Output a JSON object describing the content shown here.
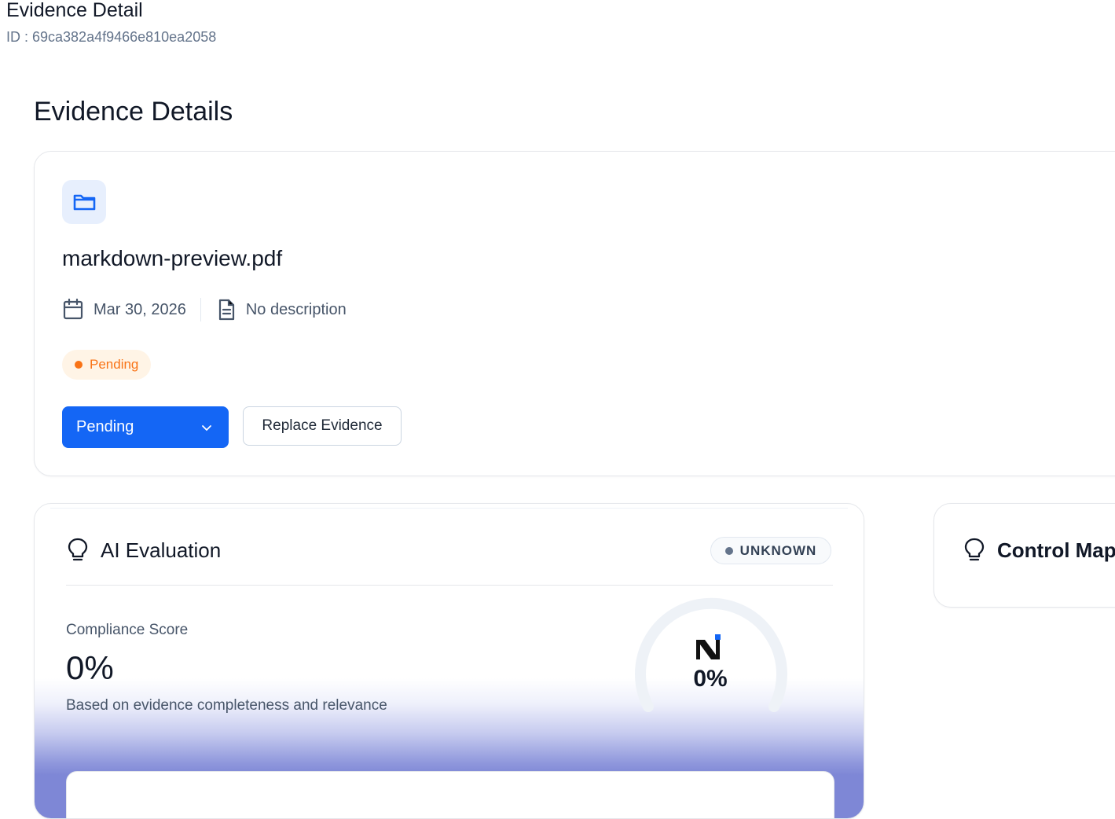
{
  "header": {
    "title": "Evidence Detail",
    "id_label": "ID : 69ca382a4f9466e810ea2058"
  },
  "section": {
    "title": "Evidence Details"
  },
  "evidence": {
    "icon": "folder-icon",
    "file_name": "markdown-preview.pdf",
    "date": "Mar 30, 2026",
    "description": "No description",
    "status_badge": "Pending",
    "status_select_value": "Pending",
    "replace_button_label": "Replace Evidence",
    "colors": {
      "accent": "#1466f5",
      "pending": "#f97316",
      "pending_background": "#fff4e6",
      "icon_tile": "#e7effd"
    }
  },
  "ai_evaluation": {
    "title": "AI Evaluation",
    "icon": "lightbulb-icon",
    "status": "UNKNOWN",
    "score_label": "Compliance Score",
    "score_value": "0%",
    "score_note": "Based on evidence completeness and relevance",
    "gauge_percent": 0,
    "gauge_value": "0%"
  },
  "control_mapping": {
    "title": "Control Map",
    "icon": "lightbulb-icon"
  }
}
